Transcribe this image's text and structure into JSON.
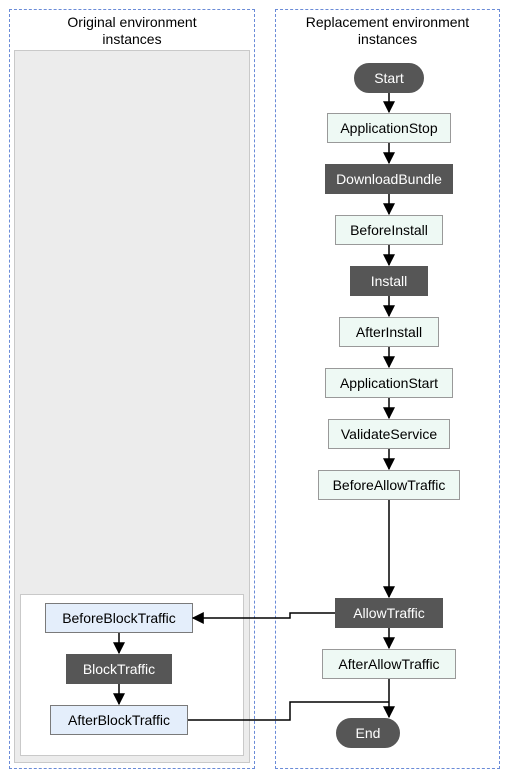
{
  "left": {
    "title": "Original environment\ninstances",
    "nodes": {
      "beforeBlock": "BeforeBlockTraffic",
      "block": "BlockTraffic",
      "afterBlock": "AfterBlockTraffic"
    }
  },
  "right": {
    "title": "Replacement environment\ninstances",
    "nodes": {
      "start": "Start",
      "appStop": "ApplicationStop",
      "download": "DownloadBundle",
      "beforeInstall": "BeforeInstall",
      "install": "Install",
      "afterInstall": "AfterInstall",
      "appStart": "ApplicationStart",
      "validate": "ValidateService",
      "beforeAllow": "BeforeAllowTraffic",
      "allow": "AllowTraffic",
      "afterAllow": "AfterAllowTraffic",
      "end": "End"
    }
  },
  "colors": {
    "dashBorder": "#6a8bd7",
    "shaded": "#ececec",
    "userFill": "#eef9f4",
    "sysFill": "#565656",
    "blueFill": "#e4eefb",
    "arrow": "#000000"
  }
}
